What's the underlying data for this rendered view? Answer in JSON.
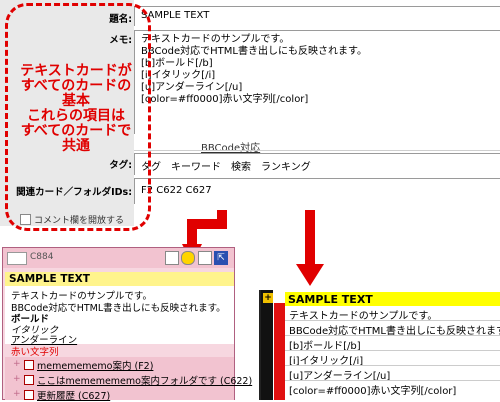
{
  "editor": {
    "labels": {
      "title": "題名:",
      "memo": "メモ:",
      "tags": "タグ:",
      "related": "関連カード／フォルダIDs:"
    },
    "title_value": "SAMPLE TEXT",
    "memo_lines": [
      "テキストカードのサンプルです。",
      "BBCode対応でHTML書き出しにも反映されます。",
      "[b]ボールド[/b]",
      "[i]イタリック[/i]",
      "[u]アンダーライン[/u]",
      "[color=#ff0000]赤い文字列[/color]"
    ],
    "bbcode_note": "BBCode対応",
    "tags_value": "タグ　キーワード　検索　ランキング",
    "related_value": "F2 C622 C627",
    "comment_checkbox_label": "コメント欄を開放する",
    "callout_lines": [
      "テキストカードが",
      "すべてのカードの",
      "基本",
      "これらの項目は",
      "すべてのカードで",
      "共通"
    ]
  },
  "card_pink": {
    "id_label": "C884",
    "title": "SAMPLE TEXT",
    "lines": [
      "テキストカードのサンプルです。",
      "BBCode対応でHTML書き出しにも反映されます。",
      "ボールド",
      "イタリック",
      "アンダーライン",
      "赤い文字列"
    ],
    "links": [
      "mememememo案内 (F2)",
      "ここはmememememo案内フォルダです (C622)",
      "更新履歴 (C627)"
    ]
  },
  "card_yellow": {
    "title": "SAMPLE TEXT",
    "lines": [
      "テキストカードのサンプルです。",
      "BBCode対応でHTML書き出しにも反映されます。",
      "[b]ボールド[/b]",
      "[i]イタリック[/i]",
      "[u]アンダーライン[/u]",
      "[color=#ff0000]赤い文字列[/color]"
    ]
  },
  "colors": {
    "accent_red": "#e00000",
    "pink_bg": "#f7d7e0",
    "title_yellow": "#ffff00"
  }
}
